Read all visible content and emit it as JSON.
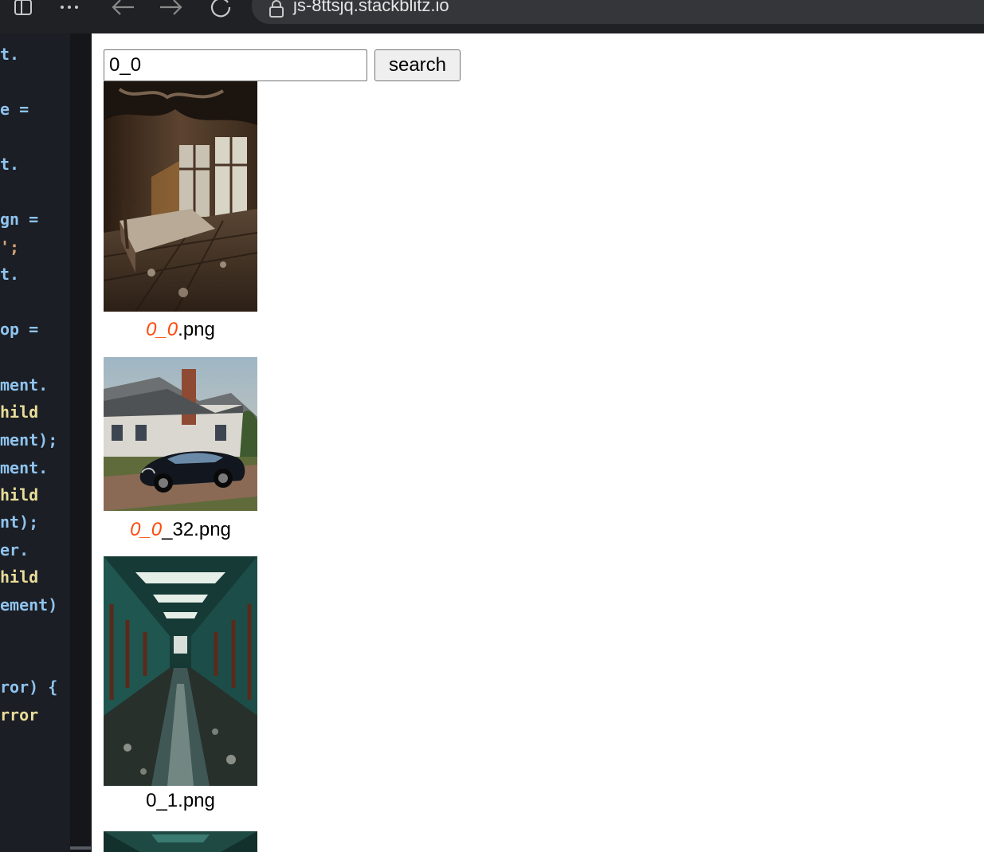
{
  "browser": {
    "url": "js-8ttsjq.stackblitz.io",
    "icons": [
      "sidebar-icon",
      "more-icon",
      "back-icon",
      "forward-icon",
      "reload-icon",
      "lock-icon"
    ]
  },
  "editor": {
    "lines": [
      {
        "text": "t.",
        "kind": "prop"
      },
      {
        "text": "e =",
        "kind": "prop"
      },
      {
        "text": "t.",
        "kind": "prop"
      },
      {
        "text": "gn =",
        "kind": "prop"
      },
      {
        "text": "';",
        "kind": "str"
      },
      {
        "text": "t.",
        "kind": "prop"
      },
      {
        "text": "op =",
        "kind": "prop"
      },
      {
        "text": "ment.",
        "kind": "prop"
      },
      {
        "text": "hild",
        "kind": "fn"
      },
      {
        "text": "ment);",
        "kind": "prop"
      },
      {
        "text": "ment.",
        "kind": "prop"
      },
      {
        "text": "hild",
        "kind": "fn"
      },
      {
        "text": "nt);",
        "kind": "prop"
      },
      {
        "text": "er.",
        "kind": "prop"
      },
      {
        "text": "hild",
        "kind": "fn"
      },
      {
        "text": "ement)",
        "kind": "prop"
      },
      {
        "text": "ror) {",
        "kind": "prop"
      },
      {
        "text": "rror",
        "kind": "fn"
      }
    ]
  },
  "search": {
    "value": "0_0",
    "button_label": "search"
  },
  "results": [
    {
      "highlight": "0_0",
      "rest": ".png",
      "scene": "abandoned-bedroom"
    },
    {
      "highlight": "0_0",
      "rest": "_32.png",
      "scene": "car-house"
    },
    {
      "highlight": "",
      "rest": "0_1.png",
      "scene": "flooded-hallway"
    },
    {
      "highlight": "",
      "rest": "",
      "scene": "hallway-partial"
    }
  ],
  "colors": {
    "highlight": "#ff4a0a",
    "editor_bg": "#1b1e24",
    "chrome_bg": "#202124"
  }
}
